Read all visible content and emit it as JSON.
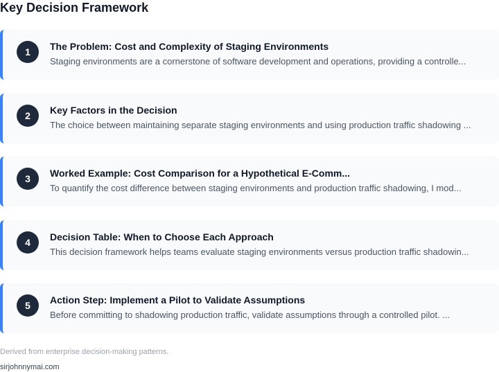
{
  "page_title": "Key Decision Framework",
  "cards": [
    {
      "number": "1",
      "title": "The Problem: Cost and Complexity of Staging Environments",
      "summary": "Staging environments are a cornerstone of software development and operations, providing a controlle..."
    },
    {
      "number": "2",
      "title": "Key Factors in the Decision",
      "summary": "The choice between maintaining separate staging environments and using production traffic shadowing ..."
    },
    {
      "number": "3",
      "title": "Worked Example: Cost Comparison for a Hypothetical E-Comm...",
      "summary": "To quantify the cost difference between staging environments and production traffic shadowing, I mod..."
    },
    {
      "number": "4",
      "title": "Decision Table: When to Choose Each Approach",
      "summary": "This decision framework helps teams evaluate staging environments versus production traffic shadowin..."
    },
    {
      "number": "5",
      "title": "Action Step: Implement a Pilot to Validate Assumptions",
      "summary": "Before committing to shadowing production traffic, validate assumptions through a controlled pilot. ..."
    }
  ],
  "footer": {
    "source_note": "Derived from enterprise decision-making patterns.",
    "site": "sirjohnnymai.com"
  },
  "colors": {
    "accent": "#3b82f6",
    "number_badge": "#1e293b",
    "card_background": "#f8fafc"
  }
}
